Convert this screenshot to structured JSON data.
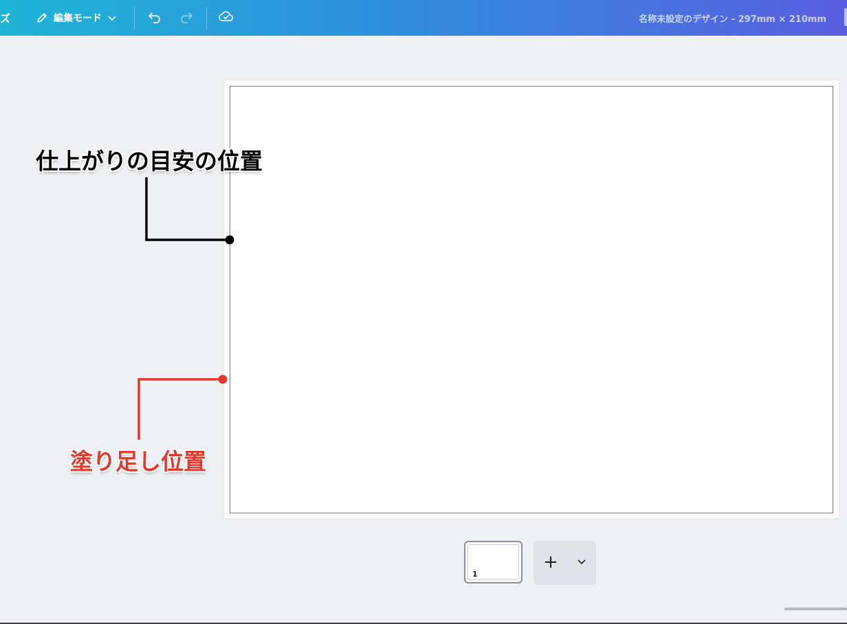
{
  "topbar": {
    "resize_tail": "ズ",
    "edit_mode_label": "編集モード",
    "doc_title": "名称未設定のデザイン - 297mm × 210mm"
  },
  "annotations": {
    "trim_label": "仕上がりの目安の位置",
    "bleed_label": "塗り足し位置"
  },
  "page_strip": {
    "page_number": "1",
    "add_label": "+"
  },
  "colors": {
    "trim_callout": "#000000",
    "bleed_callout": "#e3392b",
    "canvas_bg": "#eff0f4"
  }
}
